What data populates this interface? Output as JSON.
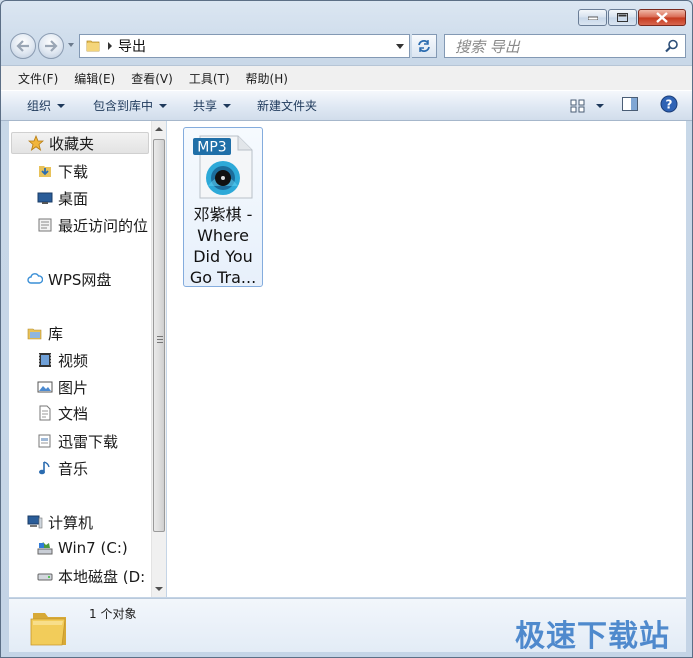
{
  "window": {
    "caption_buttons": {
      "minimize": "minimize",
      "maximize": "maximize",
      "close": "close"
    }
  },
  "address": {
    "path": "导出",
    "search_placeholder": "搜索 导出"
  },
  "menu": [
    "文件(F)",
    "编辑(E)",
    "查看(V)",
    "工具(T)",
    "帮助(H)"
  ],
  "commands": {
    "organize": "组织",
    "include_library": "包含到库中",
    "share": "共享",
    "new_folder": "新建文件夹"
  },
  "nav": {
    "favorites": "收藏夹",
    "fav_items": [
      "下载",
      "桌面",
      "最近访问的位"
    ],
    "wps": "WPS网盘",
    "libraries": "库",
    "lib_items": [
      "视频",
      "图片",
      "文档",
      "迅雷下载",
      "音乐"
    ],
    "computer": "计算机",
    "drives": [
      "Win7 (C:)",
      "本地磁盘 (D:"
    ]
  },
  "files": [
    {
      "badge": "MP3",
      "name": "邓紫棋 -\nWhere\nDid You\nGo Tra..."
    }
  ],
  "details": {
    "count": "1 个对象"
  },
  "watermark": "极速下载站",
  "colors": {
    "accent": "#3f7fc9",
    "mp3_badge": "#1f6fa8",
    "close_button": "#c4391c"
  }
}
